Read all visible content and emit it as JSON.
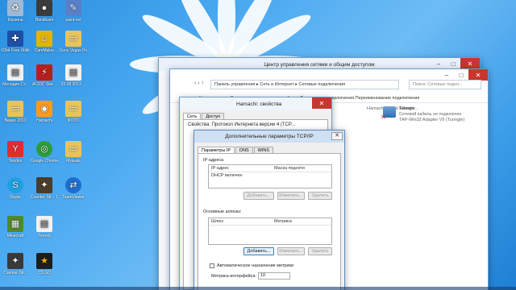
{
  "desktop": {
    "icons": [
      {
        "label": "Корзина",
        "icon": "recycle-bin-icon",
        "color": "#9fb9d6"
      },
      {
        "label": "Bandicam",
        "icon": "bandicam-icon",
        "color": "#3b3b3b"
      },
      {
        "label": "paint.net",
        "icon": "paintnet-icon",
        "color": "#5a7fc9"
      },
      {
        "label": "IObit Free Utilities",
        "icon": "iobit-icon",
        "color": "#1e4fa5"
      },
      {
        "label": "CamMaker",
        "icon": "cammaker-icon",
        "color": "#e0b400"
      },
      {
        "label": "Sony Vegas Pro 12.0",
        "icon": "folder-icon",
        "color": "#e8c45a"
      },
      {
        "label": "Мелодия Ст...",
        "icon": "document-icon",
        "color": "#f1f1f1"
      },
      {
        "label": "AC/DC Stor...",
        "icon": "acdc-icon",
        "color": "#b32020"
      },
      {
        "label": "03.08.2013 ...",
        "icon": "document-icon",
        "color": "#f1f1f1"
      },
      {
        "label": "Видео 2013",
        "icon": "folder-icon",
        "color": "#e8c45a"
      },
      {
        "label": "Hamachi",
        "icon": "hamachi-icon",
        "color": "#ff9b1a"
      },
      {
        "label": "ФОТО",
        "icon": "folder-icon",
        "color": "#e8c45a"
      },
      {
        "label": "Yandex",
        "icon": "yandex-icon",
        "color": "#e12d2d"
      },
      {
        "label": "Google Chrome",
        "icon": "chrome-icon",
        "color": "#2d9d3c"
      },
      {
        "label": "Музыка",
        "icon": "folder-icon",
        "color": "#e8c45a"
      },
      {
        "label": "Skype",
        "icon": "skype-icon",
        "color": "#1fa0e3"
      },
      {
        "label": "Counter-Str... 1.6",
        "icon": "counterstrike-icon",
        "color": "#4a3d2a"
      },
      {
        "label": "TeamViewer",
        "icon": "teamviewer-icon",
        "color": "#1d6fcf"
      },
      {
        "label": "Minecraft",
        "icon": "minecraft-icon",
        "color": "#4f8a2c"
      },
      {
        "label": "Torrent",
        "icon": "document-icon",
        "color": "#f1f1f1"
      },
      {
        "label": "Counter-Str...",
        "icon": "counterstrike-icon",
        "color": "#3a3a3a"
      },
      {
        "label": "CS GO",
        "icon": "csgo-icon",
        "color": "#1e1e1e"
      }
    ]
  },
  "netcenter": {
    "title": "Центр управления сетями и общим доступом"
  },
  "netconn": {
    "address": "Панель управления ▸ Сеть и Интернет ▸ Сетевые подключения",
    "search_placeholder": "Поиск: Сетевые подкл...",
    "toolbar": "Упорядочить ▾   Отключение сетевого устройства   Диагностика подключения   Переименование подключения",
    "conn1": "Hamachi Virtual Etherne...",
    "conn2_name": "Tunngle",
    "conn2_status": "Сетевой кабель не подключен",
    "conn2_adapter": "TAP-Win32 Adapter V9 (Tunngle)"
  },
  "hamachi": {
    "title": "Hamachi: свойства",
    "tabs": [
      "Сеть",
      "Доступ"
    ],
    "hidden_line": "Свойства: Протокол Интернета версии 4 (TCP..."
  },
  "advanced": {
    "title": "Дополнительные параметры TCP/IP",
    "close_label": "✕",
    "tabs": [
      "Параметры IP",
      "DNS",
      "WINS"
    ],
    "ip_section": "IP-адреса",
    "ip_cols": [
      "IP-адрес",
      "Маска подсети"
    ],
    "ip_rows": [
      "DHCP включен"
    ],
    "gw_section": "Основные шлюзы:",
    "gw_cols": [
      "Шлюз",
      "Метрика"
    ],
    "btn_add": "Добавить...",
    "btn_edit": "Изменить...",
    "btn_delete": "Удалить",
    "auto_metric_label": "Автоматическое назначение метрики",
    "interface_metric_label": "Метрика интерфейса:",
    "interface_metric_value": "10"
  }
}
